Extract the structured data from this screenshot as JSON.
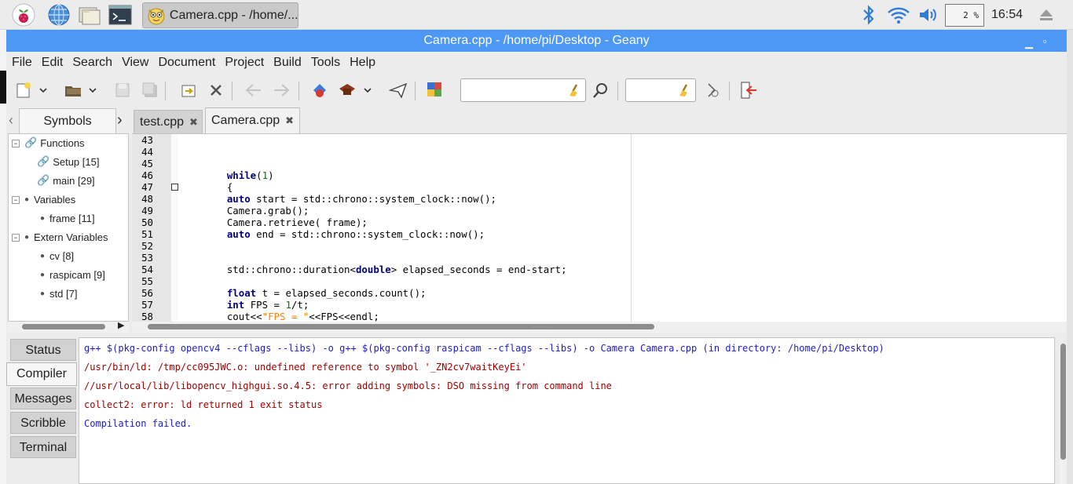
{
  "taskbar": {
    "app_title": "Camera.cpp - /home/...",
    "cpu_usage": "2 %",
    "clock": "16:54"
  },
  "window": {
    "title": "Camera.cpp - /home/pi/Desktop - Geany"
  },
  "menu": [
    "File",
    "Edit",
    "Search",
    "View",
    "Document",
    "Project",
    "Build",
    "Tools",
    "Help"
  ],
  "sidebar": {
    "tab_label": "Symbols",
    "tree": [
      {
        "label": "Functions",
        "group": true
      },
      {
        "label": "Setup [15]",
        "group": false
      },
      {
        "label": "main [29]",
        "group": false
      },
      {
        "label": "Variables",
        "group": true
      },
      {
        "label": "frame [11]",
        "group": false
      },
      {
        "label": "Extern Variables",
        "group": true
      },
      {
        "label": "cv [8]",
        "group": false
      },
      {
        "label": "raspicam [9]",
        "group": false
      },
      {
        "label": "std [7]",
        "group": false
      }
    ]
  },
  "editor": {
    "tabs": [
      {
        "label": "test.cpp",
        "active": false
      },
      {
        "label": "Camera.cpp",
        "active": true
      }
    ],
    "line_numbers": [
      "43",
      "44",
      "45",
      "46",
      "47",
      "48",
      "49",
      "50",
      "51",
      "52",
      "53",
      "54",
      "55",
      "56",
      "57",
      "58"
    ],
    "lines": [
      "",
      "",
      "",
      "    while(1)",
      "    {",
      "    auto start = std::chrono::system_clock::now();",
      "    Camera.grab();",
      "    Camera.retrieve( frame);",
      "    auto end = std::chrono::system_clock::now();",
      "",
      "",
      "    std::chrono::duration<double> elapsed_seconds = end-start;",
      "",
      "    float t = elapsed_seconds.count();",
      "    int FPS = 1/t;",
      "    cout<<\"FPS = \"<<FPS<<endl;"
    ]
  },
  "messages": {
    "tabs": [
      "Status",
      "Compiler",
      "Messages",
      "Scribble",
      "Terminal"
    ],
    "active_tab": "Compiler",
    "compiler_output": [
      {
        "text": "g++ $(pkg-config opencv4 --cflags --libs) -o g++ $(pkg-config raspicam --cflags --libs) -o Camera Camera.cpp (in directory: /home/pi/Desktop)",
        "color": "#1c1ccc"
      },
      {
        "text": "/usr/bin/ld: /tmp/cc095JWC.o: undefined reference to symbol '_ZN2cv7waitKeyEi'",
        "color": "#a00000"
      },
      {
        "text": "//usr/local/lib/libopencv_highgui.so.4.5: error adding symbols: DSO missing from command line",
        "color": "#a00000"
      },
      {
        "text": "collect2: error: ld returned 1 exit status",
        "color": "#a00000"
      },
      {
        "text": "Compilation failed.",
        "color": "#1c1ccc"
      }
    ]
  },
  "colors": {
    "titlebar": "#4d98f5",
    "keyword": "#00007f",
    "number": "#007f00",
    "string": "#ff7f00",
    "error": "#a00000",
    "info": "#1c1ccc"
  }
}
